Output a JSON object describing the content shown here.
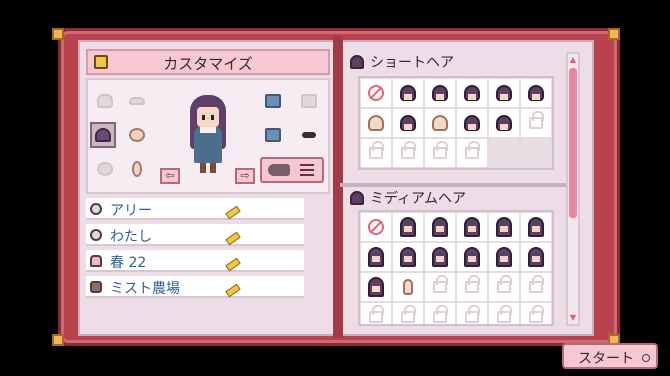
{
  "header": {
    "title": "カスタマイズ",
    "icon": "shirt-icon"
  },
  "profile": {
    "rows": [
      {
        "icon": "name-icon",
        "text": "アリー"
      },
      {
        "icon": "pronoun-icon",
        "text": "わたし"
      },
      {
        "icon": "birthday-icon",
        "text": "春 22"
      },
      {
        "icon": "farm-icon",
        "text": "ミスト農場"
      }
    ]
  },
  "sections": {
    "short_hair": {
      "title": "ショートヘア",
      "icon": "hair-icon"
    },
    "medium_hair": {
      "title": "ミディアムヘア",
      "icon": "hair-icon"
    }
  },
  "controls": {
    "start_label": "スタート",
    "prev_arrow": "⇦",
    "next_arrow": "⇨",
    "scroll_up": "▲",
    "scroll_down": "▼"
  },
  "colors": {
    "book": "#b8434f",
    "page": "#ecdde6",
    "accent": "#f5c8d2",
    "text_blue": "#2d5f9a"
  }
}
